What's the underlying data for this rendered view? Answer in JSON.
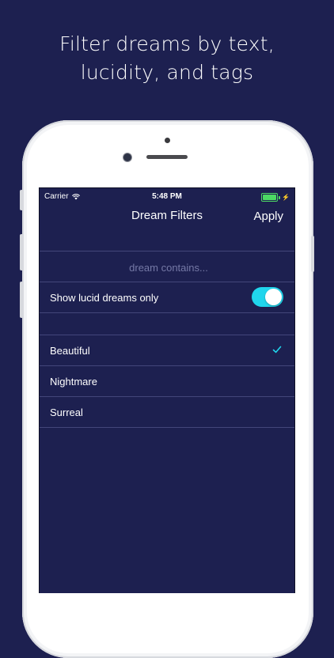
{
  "headline": {
    "line1": "Filter dreams by text,",
    "line2": "lucidity, and tags"
  },
  "status_bar": {
    "carrier": "Carrier",
    "time": "5:48 PM",
    "battery_level": 1.0
  },
  "nav": {
    "title": "Dream Filters",
    "apply_label": "Apply"
  },
  "search": {
    "value": "",
    "placeholder": "dream contains..."
  },
  "lucid_toggle": {
    "label": "Show lucid dreams only",
    "on": true
  },
  "tags": [
    {
      "label": "Beautiful",
      "checked": true
    },
    {
      "label": "Nightmare",
      "checked": false
    },
    {
      "label": "Surreal",
      "checked": false
    }
  ],
  "colors": {
    "background": "#1d2050",
    "accent": "#20d5ec",
    "separator": "#43467a",
    "battery": "#4cd964"
  },
  "icons": {
    "wifi": "wifi-icon",
    "battery": "battery-icon",
    "charging": "bolt-icon",
    "checkmark": "checkmark-icon"
  }
}
